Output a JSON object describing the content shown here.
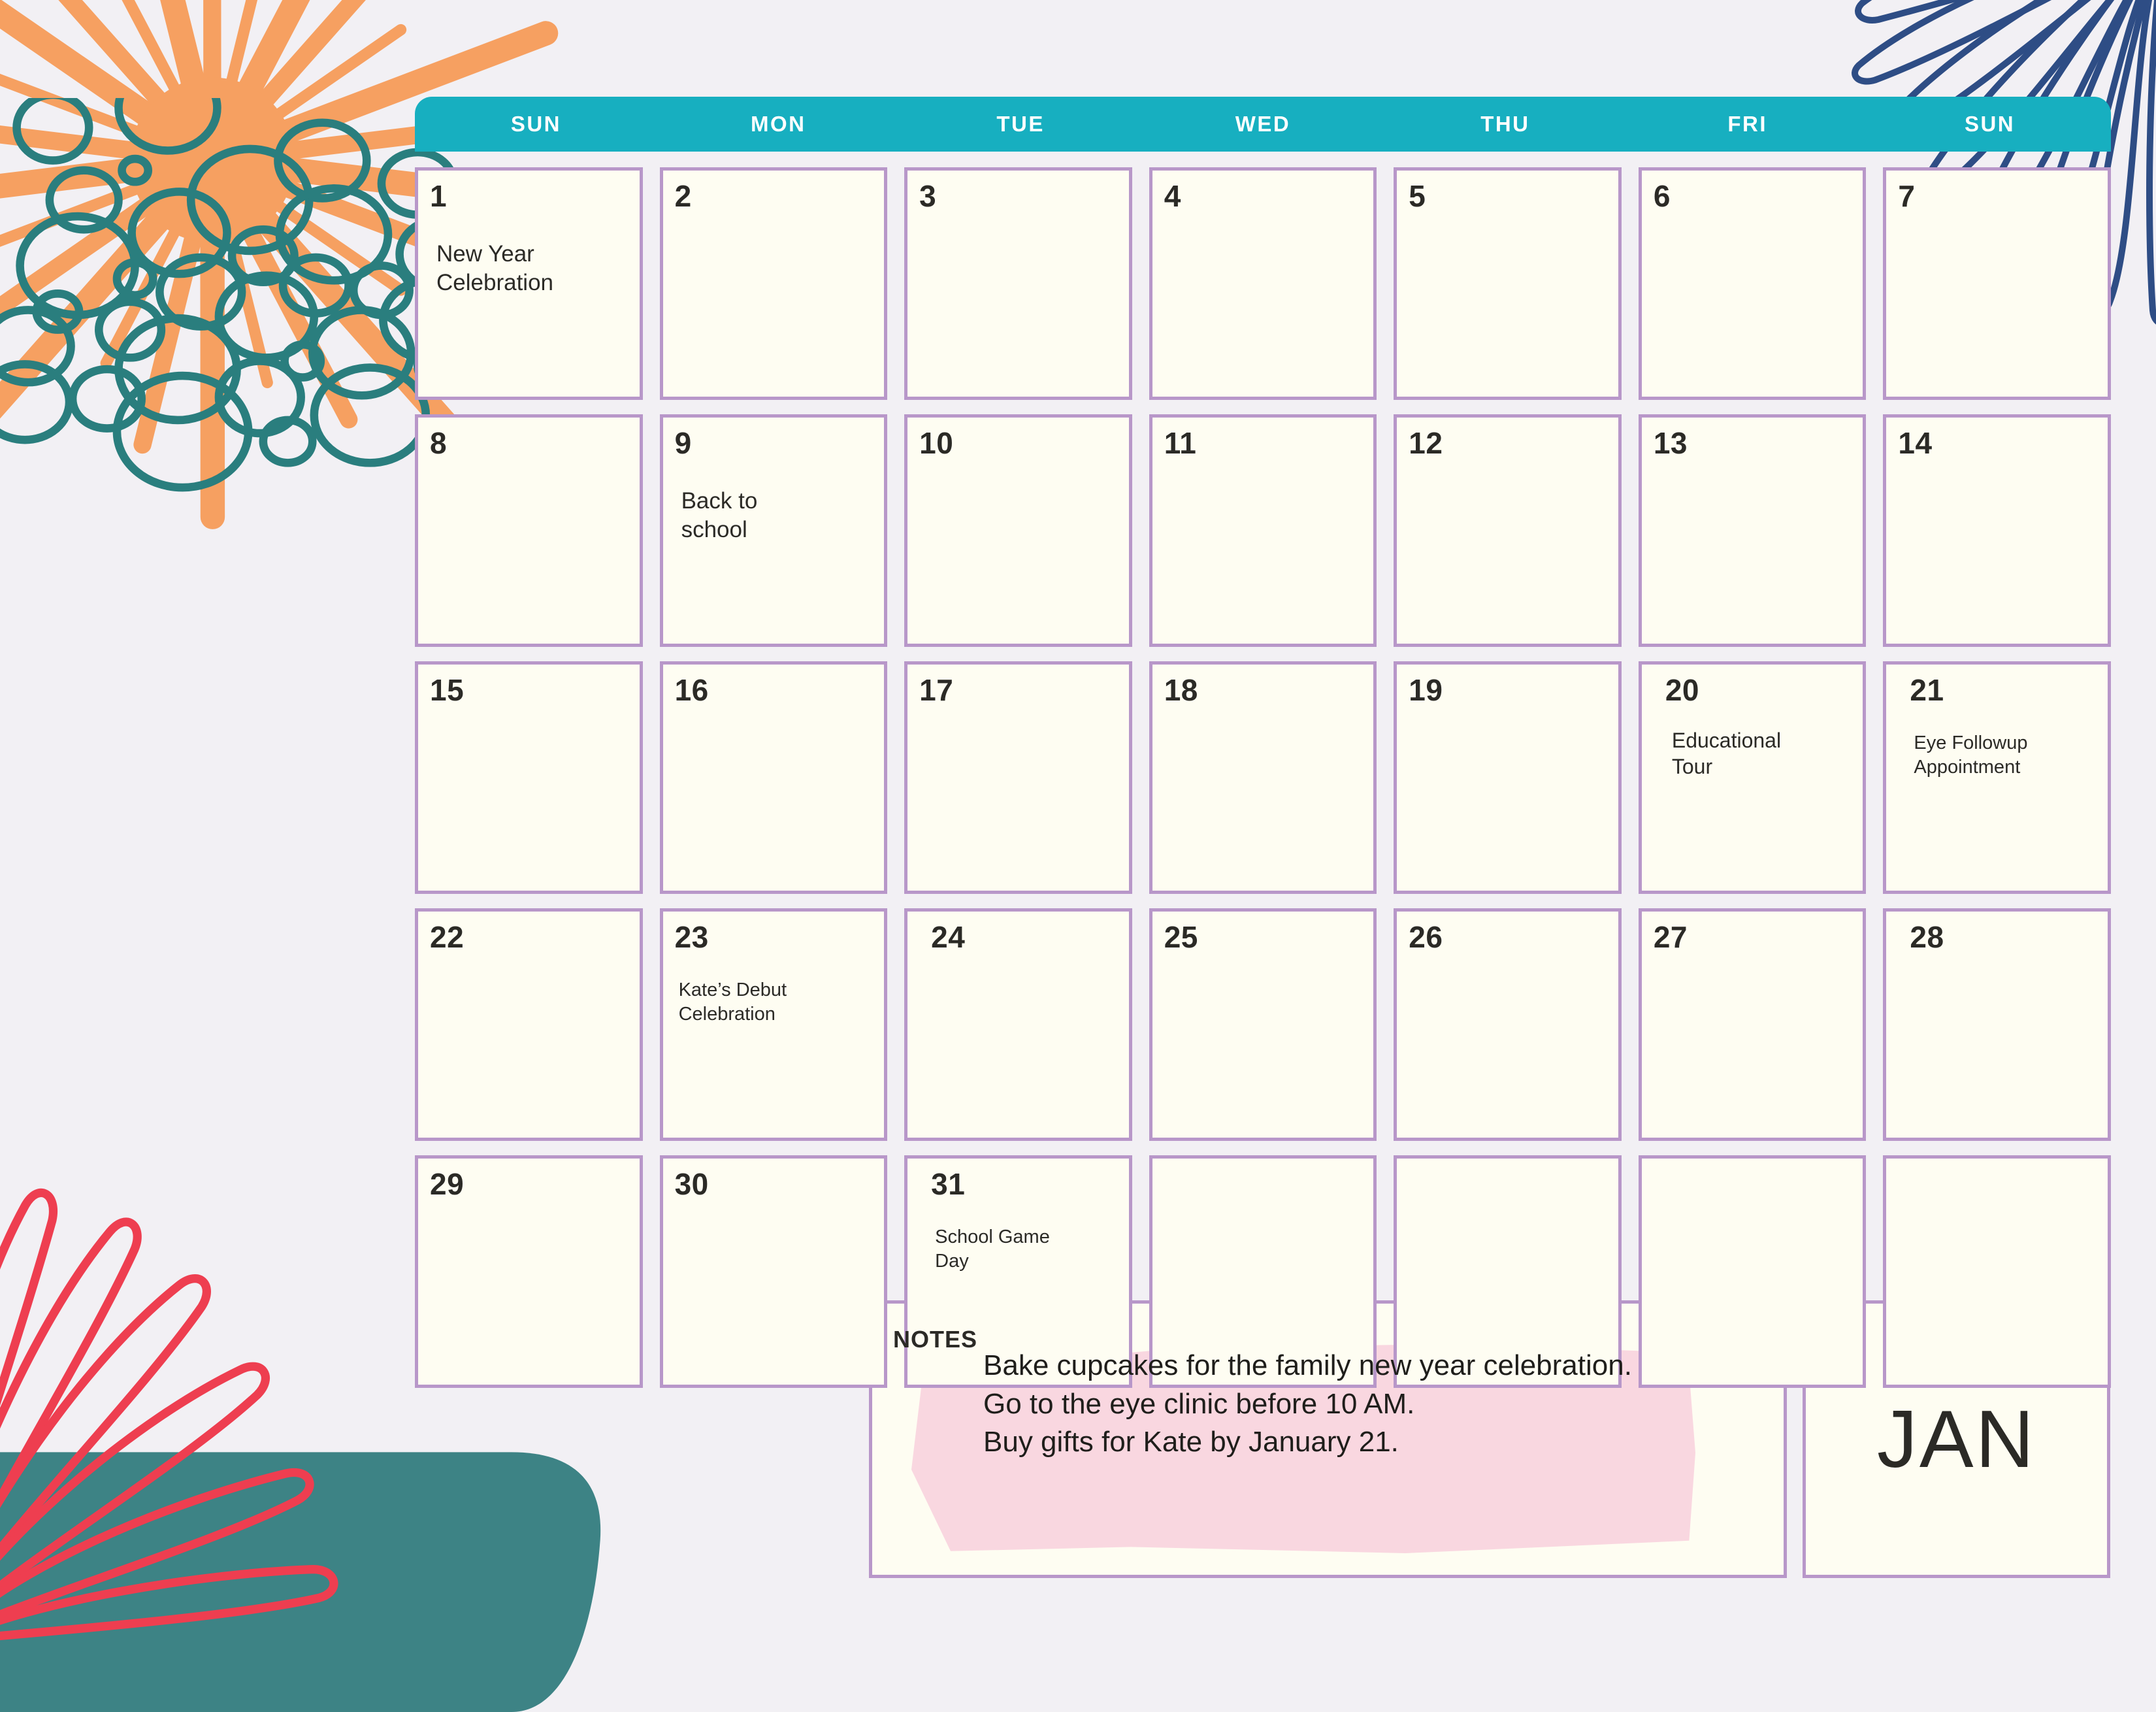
{
  "theme": {
    "background": "#F2F0F4",
    "header_teal": "#17AFC0",
    "cell_bg": "#FEFDF2",
    "cell_border": "#B897C9",
    "text_dark": "#2B2A26",
    "accent_orange": "#F6A061",
    "accent_teal_circles": "#2A7E7E",
    "accent_pot_teal": "#3D8385",
    "accent_red_leaf": "#EE3E50",
    "accent_navy_leaf": "#2E4D85",
    "notes_highlight_pink": "#F9D7E0"
  },
  "weekdays": [
    "SUN",
    "MON",
    "TUE",
    "WED",
    "THU",
    "FRI",
    "SUN"
  ],
  "days": [
    {
      "num": "1",
      "event": "New Year\nCelebration",
      "style": "big",
      "indent": false
    },
    {
      "num": "2",
      "event": "",
      "style": "",
      "indent": false
    },
    {
      "num": "3",
      "event": "",
      "style": "",
      "indent": false
    },
    {
      "num": "4",
      "event": "",
      "style": "",
      "indent": false
    },
    {
      "num": "5",
      "event": "",
      "style": "",
      "indent": false
    },
    {
      "num": "6",
      "event": "",
      "style": "",
      "indent": false
    },
    {
      "num": "7",
      "event": "",
      "style": "",
      "indent": false
    },
    {
      "num": "8",
      "event": "",
      "style": "",
      "indent": false
    },
    {
      "num": "9",
      "event": "Back to\nschool",
      "style": "big",
      "indent": false
    },
    {
      "num": "10",
      "event": "",
      "style": "",
      "indent": false
    },
    {
      "num": "11",
      "event": "",
      "style": "",
      "indent": false
    },
    {
      "num": "12",
      "event": "",
      "style": "",
      "indent": false
    },
    {
      "num": "13",
      "event": "",
      "style": "",
      "indent": false
    },
    {
      "num": "14",
      "event": "",
      "style": "",
      "indent": false
    },
    {
      "num": "15",
      "event": "",
      "style": "",
      "indent": false
    },
    {
      "num": "16",
      "event": "",
      "style": "",
      "indent": false
    },
    {
      "num": "17",
      "event": "",
      "style": "",
      "indent": false
    },
    {
      "num": "18",
      "event": "",
      "style": "",
      "indent": false
    },
    {
      "num": "19",
      "event": "",
      "style": "",
      "indent": false
    },
    {
      "num": "20",
      "event": "Educational\nTour",
      "style": "",
      "indent": true
    },
    {
      "num": "21",
      "event": "Eye Followup\nAppointment",
      "style": "small",
      "indent": true
    },
    {
      "num": "22",
      "event": "",
      "style": "",
      "indent": false
    },
    {
      "num": "23",
      "event": "Kate’s Debut\nCelebration",
      "style": "small",
      "indent": false
    },
    {
      "num": "24",
      "event": "",
      "style": "",
      "indent": true
    },
    {
      "num": "25",
      "event": "",
      "style": "",
      "indent": false
    },
    {
      "num": "26",
      "event": "",
      "style": "",
      "indent": false
    },
    {
      "num": "27",
      "event": "",
      "style": "",
      "indent": false
    },
    {
      "num": "28",
      "event": "",
      "style": "",
      "indent": true
    },
    {
      "num": "29",
      "event": "",
      "style": "",
      "indent": false
    },
    {
      "num": "30",
      "event": "",
      "style": "",
      "indent": false
    },
    {
      "num": "31",
      "event": "School Game\nDay",
      "style": "small",
      "indent": true
    },
    {
      "num": "",
      "event": "",
      "style": "",
      "indent": false
    },
    {
      "num": "",
      "event": "",
      "style": "",
      "indent": false
    },
    {
      "num": "",
      "event": "",
      "style": "",
      "indent": false
    },
    {
      "num": "",
      "event": "",
      "style": "",
      "indent": false
    }
  ],
  "notes": {
    "label": "NOTES",
    "text": "Bake cupcakes for the family new year celebration.\nGo to the eye clinic before 10 AM.\nBuy gifts for Kate by January 21."
  },
  "month": {
    "label": "JAN"
  },
  "decorations": [
    {
      "name": "orange-sunburst-icon",
      "color": "#F6A061"
    },
    {
      "name": "teal-circles-icon",
      "color": "#2A7E7E"
    },
    {
      "name": "navy-fan-leaf-icon",
      "color": "#2E4D85"
    },
    {
      "name": "red-fan-leaf-icon",
      "color": "#EE3E50"
    },
    {
      "name": "teal-pot-icon",
      "color": "#3D8385"
    }
  ]
}
